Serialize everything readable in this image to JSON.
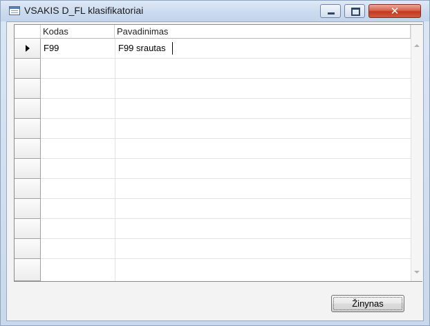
{
  "window": {
    "title": "VSAKIS D_FL klasifikatoriai",
    "icon": "table-window-icon",
    "controls": {
      "minimize": "minimize-icon",
      "maximize": "maximize-icon",
      "close": "close-icon",
      "close_glyph": "✕"
    }
  },
  "grid": {
    "columns": [
      {
        "key": "kodas",
        "label": "Kodas"
      },
      {
        "key": "pavadinimas",
        "label": "Pavadinimas"
      }
    ],
    "rows": [
      {
        "kodas": "F99",
        "pavadinimas": "F99 srautas",
        "current": true
      }
    ],
    "empty_rows": 10
  },
  "buttons": {
    "zinynas_label": "Žinynas"
  },
  "colors": {
    "close_button": "#c2391f",
    "title_bar": "#cbdbef"
  }
}
